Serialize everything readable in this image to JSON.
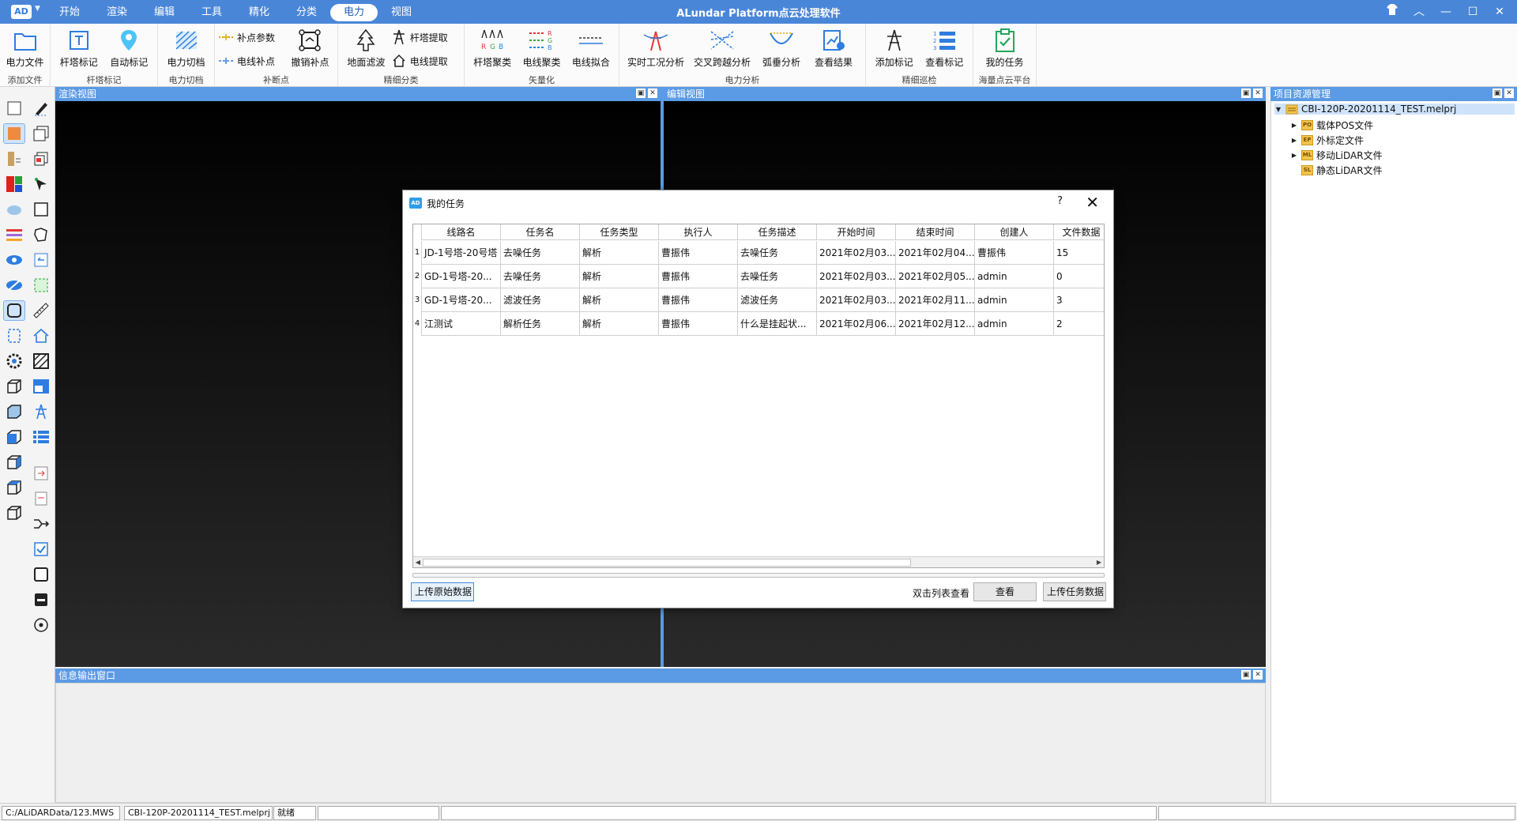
{
  "app": {
    "logo": "AD",
    "title": "ALundar Platform点云处理软件"
  },
  "menu": [
    "开始",
    "渲染",
    "编辑",
    "工具",
    "精化",
    "分类",
    "电力",
    "视图"
  ],
  "menu_active_index": 6,
  "ribbon": {
    "groups": {
      "add_file": {
        "label": "添加文件",
        "btn": "电力文件"
      },
      "tower_mark": {
        "label": "杆塔标记",
        "btn1": "杆塔标记",
        "btn2": "自动标记"
      },
      "cut": {
        "label": "电力切档",
        "btn": "电力切档"
      },
      "fill": {
        "label": "补断点",
        "small1": "补点参数",
        "small2": "电线补点",
        "btn": "撤销补点"
      },
      "fine_class": {
        "label": "精细分类",
        "btn": "地面滤波",
        "small1": "杆塔提取",
        "small2": "电线提取"
      },
      "vector": {
        "label": "矢量化",
        "btn1": "杆塔聚类",
        "btn2": "电线聚类",
        "btn3": "电线拟合"
      },
      "analysis": {
        "label": "电力分析",
        "btn1": "实时工况分析",
        "btn2": "交叉跨越分析",
        "btn3": "弧垂分析",
        "btn4": "查看结果"
      },
      "patrol": {
        "label": "精细巡检",
        "btn1": "添加标记",
        "btn2": "查看标记"
      },
      "platform": {
        "label": "海量点云平台",
        "btn": "我的任务"
      }
    }
  },
  "panels": {
    "render_view": "渲染视图",
    "edit_view": "编辑视图",
    "project": "项目资源管理",
    "info": "信息输出窗口"
  },
  "project_tree": {
    "root": "CBI-120P-20201114_TEST.melprj",
    "items": [
      {
        "badge": "PO",
        "label": "载体POS文件",
        "expandable": true
      },
      {
        "badge": "EP",
        "label": "外标定文件",
        "expandable": true
      },
      {
        "badge": "ML",
        "label": "移动LiDAR文件",
        "expandable": true
      },
      {
        "badge": "SL",
        "label": "静态LiDAR文件",
        "expandable": false
      }
    ]
  },
  "status": {
    "path": "C:/ALiDARData/123.MWS",
    "project": "CBI-120P-20201114_TEST.melprj",
    "state": "就绪"
  },
  "dialog": {
    "title": "我的任务",
    "help": "?",
    "close": "✕",
    "columns": [
      "线路名",
      "任务名",
      "任务类型",
      "执行人",
      "任务描述",
      "开始时间",
      "结束时间",
      "创建人",
      "文件数据"
    ],
    "rows": [
      {
        "num": "1",
        "cells": [
          "JD-1号塔-20号塔",
          "去噪任务",
          "解析",
          "曹振伟",
          "去噪任务",
          "2021年02月03...",
          "2021年02月04...",
          "曹振伟",
          "15"
        ]
      },
      {
        "num": "2",
        "cells": [
          "GD-1号塔-20...",
          "去噪任务",
          "解析",
          "曹振伟",
          "去噪任务",
          "2021年02月03...",
          "2021年02月05...",
          "admin",
          "0"
        ]
      },
      {
        "num": "3",
        "cells": [
          "GD-1号塔-20...",
          "滤波任务",
          "解析",
          "曹振伟",
          "滤波任务",
          "2021年02月03...",
          "2021年02月11...",
          "admin",
          "3"
        ]
      },
      {
        "num": "4",
        "cells": [
          "江测试",
          "解析任务",
          "解析",
          "曹振伟",
          "什么是挂起状...",
          "2021年02月06...",
          "2021年02月12...",
          "admin",
          "2"
        ]
      }
    ],
    "upload_raw": "上传原始数据",
    "hint": "双击列表查看",
    "view": "查看",
    "upload_task": "上传任务数据"
  },
  "colors": {
    "accent": "#4a86d8",
    "panel_header": "#5b9ae4"
  }
}
